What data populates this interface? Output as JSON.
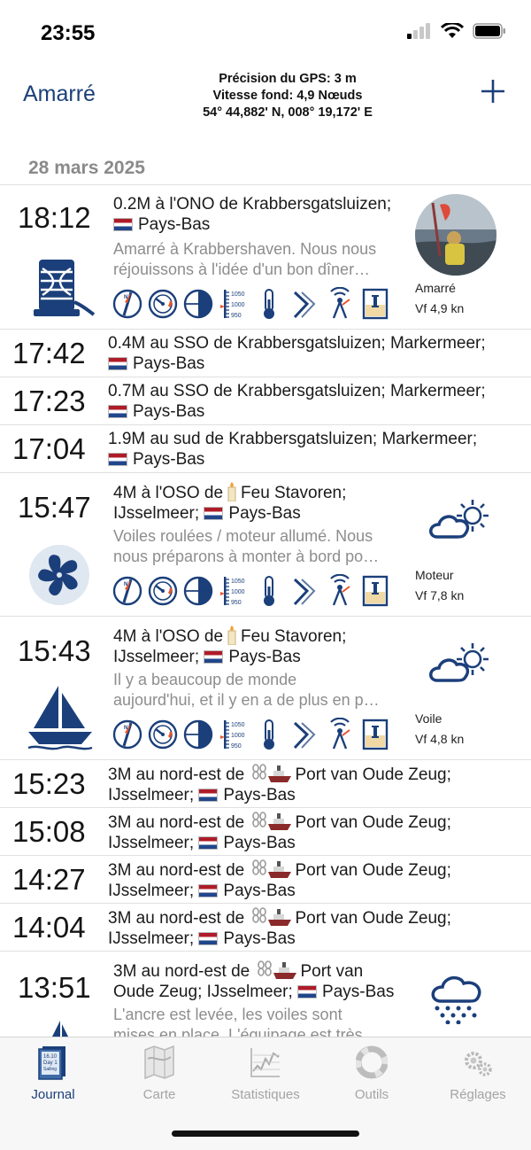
{
  "status": {
    "time": "23:55"
  },
  "nav": {
    "back_label": "Amarré",
    "gps_precision": "Précision du GPS: 3 m",
    "speed_ground": "Vitesse fond: 4,9 Nœuds",
    "position": "54° 44,882' N, 008° 19,172' E"
  },
  "date_header": "28 mars 2025",
  "entries": [
    {
      "time": "18:12",
      "line1": "0.2M à l'ONO de Krabbersgatsluizen;",
      "line2": "Pays-Bas",
      "note1": "Amarré à Krabbershaven. Nous nous",
      "note2": "réjouissons à l'idée d'un bon dîner…",
      "side_status": "Amarré",
      "side_speed": "Vf 4,9 kn",
      "icon": "mooring-icon"
    },
    {
      "time": "17:42",
      "line1": "0.4M au SSO de Krabbersgatsluizen; Markermeer;",
      "line2": "Pays-Bas"
    },
    {
      "time": "17:23",
      "line1": "0.7M au SSO de Krabbersgatsluizen; Markermeer;",
      "line2": "Pays-Bas"
    },
    {
      "time": "17:04",
      "line1": "1.9M au sud de Krabbersgatsluizen; Markermeer;",
      "line2": "Pays-Bas"
    },
    {
      "time": "15:47",
      "line1a": "4M à l'OSO de",
      "line1b": "Feu Stavoren;",
      "line2a": "IJsselmeer;",
      "line2b": "Pays-Bas",
      "note1": "Voiles roulées / moteur allumé. Nous",
      "note2": "nous préparons à monter à bord po…",
      "side_status": "Moteur",
      "side_speed": "Vf 7,8 kn",
      "icon": "propeller-icon"
    },
    {
      "time": "15:43",
      "line1a": "4M à l'OSO de",
      "line1b": "Feu Stavoren;",
      "line2a": "IJsselmeer;",
      "line2b": "Pays-Bas",
      "note1": "Il y a beaucoup de monde",
      "note2": "aujourd'hui, et il y en a de plus en p…",
      "side_status": "Voile",
      "side_speed": "Vf 4,8 kn",
      "icon": "sailboat-icon"
    },
    {
      "time": "15:23",
      "line1a": "3M au nord-est de",
      "line1b": "Port van Oude Zeug;",
      "line2a": "IJsselmeer;",
      "line2b": "Pays-Bas"
    },
    {
      "time": "15:08",
      "line1a": "3M au nord-est de",
      "line1b": "Port van Oude Zeug;",
      "line2a": "IJsselmeer;",
      "line2b": "Pays-Bas"
    },
    {
      "time": "14:27",
      "line1a": "3M au nord-est de",
      "line1b": "Port van Oude Zeug;",
      "line2a": "IJsselmeer;",
      "line2b": "Pays-Bas"
    },
    {
      "time": "14:04",
      "line1a": "3M au nord-est de",
      "line1b": "Port van Oude Zeug;",
      "line2a": "IJsselmeer;",
      "line2b": "Pays-Bas"
    },
    {
      "time": "13:51",
      "line1a": "3M au nord-est de",
      "line1b": "Port van",
      "line2a": "Oude Zeug; IJsselmeer;",
      "line2b": "Pays-Bas",
      "note1": "L'ancre est levée, les voiles sont",
      "note2": "mises en place. L'équipage est très"
    }
  ],
  "baro": {
    "hi": "1050",
    "mid": "1000",
    "lo": "950"
  },
  "tabs": [
    {
      "label": "Journal",
      "icon": "logbook-icon",
      "active": true,
      "book_l1": "16.10",
      "book_l2": "Day 1",
      "book_l3": "Sailing"
    },
    {
      "label": "Carte",
      "icon": "map-icon"
    },
    {
      "label": "Statistiques",
      "icon": "chart-icon"
    },
    {
      "label": "Outils",
      "icon": "lifebuoy-icon"
    },
    {
      "label": "Réglages",
      "icon": "gears-icon"
    }
  ],
  "colors": {
    "navy": "#1b3f7a",
    "orange": "#e8532a",
    "note_gray": "#8d8d8d"
  }
}
